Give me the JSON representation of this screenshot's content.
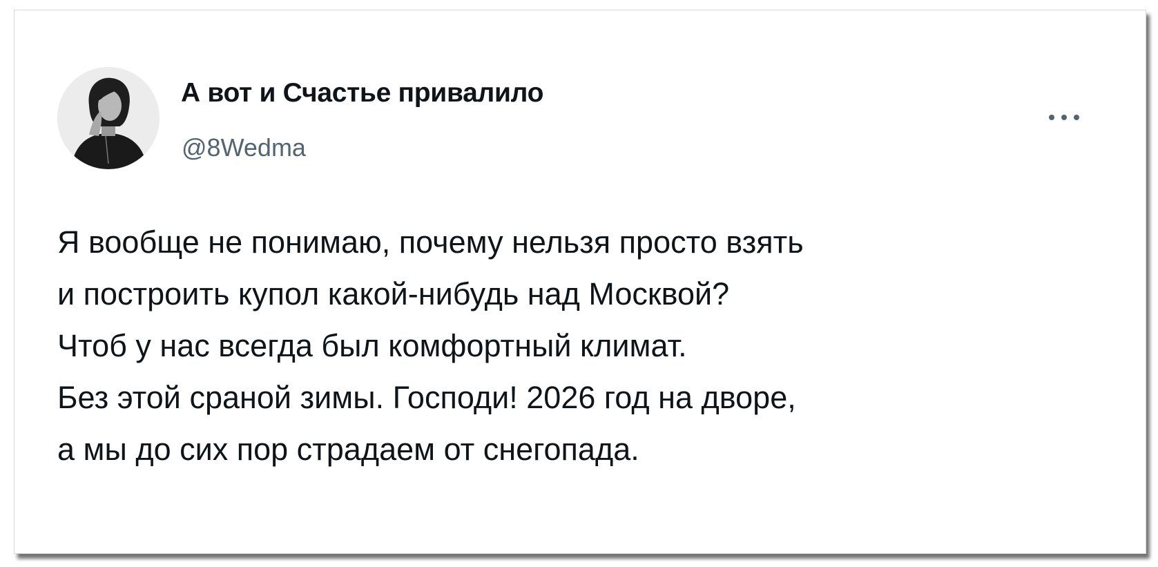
{
  "post": {
    "author_name": "А вот и Счастье привалило",
    "author_handle": "@8Wedma",
    "text_lines": [
      "Я вообще не понимаю, почему нельзя просто взять",
      "и построить купол какой-нибудь над Москвой?",
      "Чтоб у нас всегда был комфортный климат.",
      "Без этой сраной зимы. Господи! 2026 год на дворе,",
      "а мы до сих пор страдаем от снегопада."
    ]
  },
  "icons": {
    "more": "more-horizontal-icon",
    "avatar": "profile-photo"
  },
  "colors": {
    "text_primary": "#0f1419",
    "text_secondary": "#536471",
    "background": "#ffffff"
  }
}
